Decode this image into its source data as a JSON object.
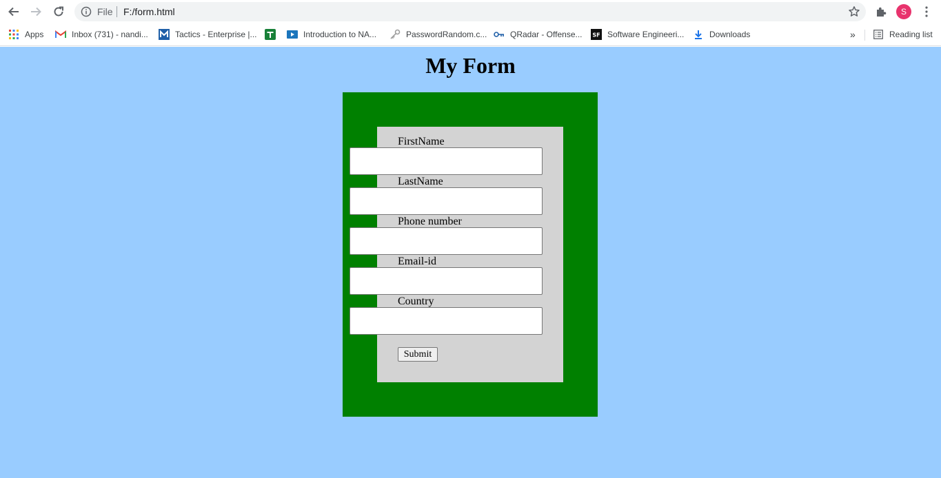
{
  "browser": {
    "omnibox": {
      "scheme_label": "File",
      "url": "F:/form.html"
    },
    "profile_initial": "S",
    "bookmarks": [
      {
        "label": "Apps",
        "icon": "apps-grid-icon"
      },
      {
        "label": "Inbox (731) - nandi...",
        "icon": "gmail-icon"
      },
      {
        "label": "Tactics - Enterprise |...",
        "icon": "mitre-icon"
      },
      {
        "label": "",
        "icon": "sheets-plus-icon"
      },
      {
        "label": "Introduction to NA...",
        "icon": "video-play-icon"
      },
      {
        "label": "PasswordRandom.c...",
        "icon": "key-icon"
      },
      {
        "label": "QRadar - Offense...",
        "icon": "qradar-key-icon"
      },
      {
        "label": "Software Engineeri...",
        "icon": "sf-logo-icon"
      },
      {
        "label": "Downloads",
        "icon": "download-icon"
      }
    ],
    "overflow_label": "»",
    "reading_list_label": "Reading list",
    "colors": {
      "avatar": "#e8336d",
      "omnibox_bg": "#f1f3f4"
    }
  },
  "page": {
    "title": "My Form",
    "colors": {
      "background": "#99ccff",
      "outer_panel": "#008000",
      "inner_panel": "#d3d3d3"
    },
    "form": {
      "fields": [
        {
          "label": "FirstName",
          "value": ""
        },
        {
          "label": "LastName",
          "value": ""
        },
        {
          "label": "Phone number",
          "value": ""
        },
        {
          "label": "Email-id",
          "value": ""
        },
        {
          "label": "Country",
          "value": ""
        }
      ],
      "submit_label": "Submit"
    }
  }
}
